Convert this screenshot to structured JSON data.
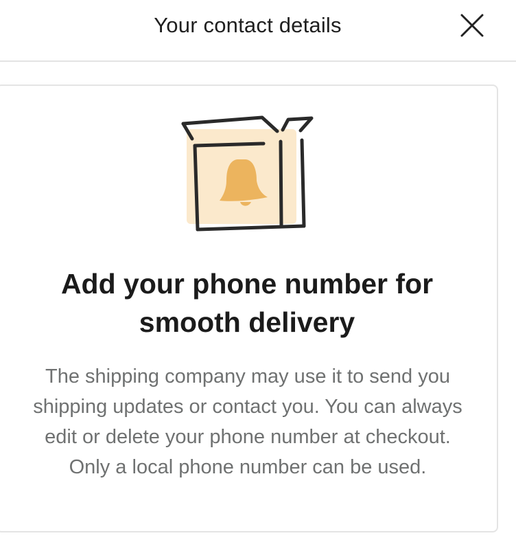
{
  "header": {
    "title": "Your contact details",
    "close_icon": "close-icon"
  },
  "card": {
    "illustration_icon": "box-with-bell-icon",
    "title": "Add your phone number for smooth delivery",
    "body": "The shipping company may use it to send you shipping updates or contact you. You can always edit or delete your phone number at checkout. Only a local phone number can be used."
  },
  "colors": {
    "illustration_fill": "#fbe9cc",
    "bell": "#ecb45e",
    "outline": "#2a2a2a",
    "body_text": "#6f7171",
    "divider": "#e3e3e3"
  }
}
